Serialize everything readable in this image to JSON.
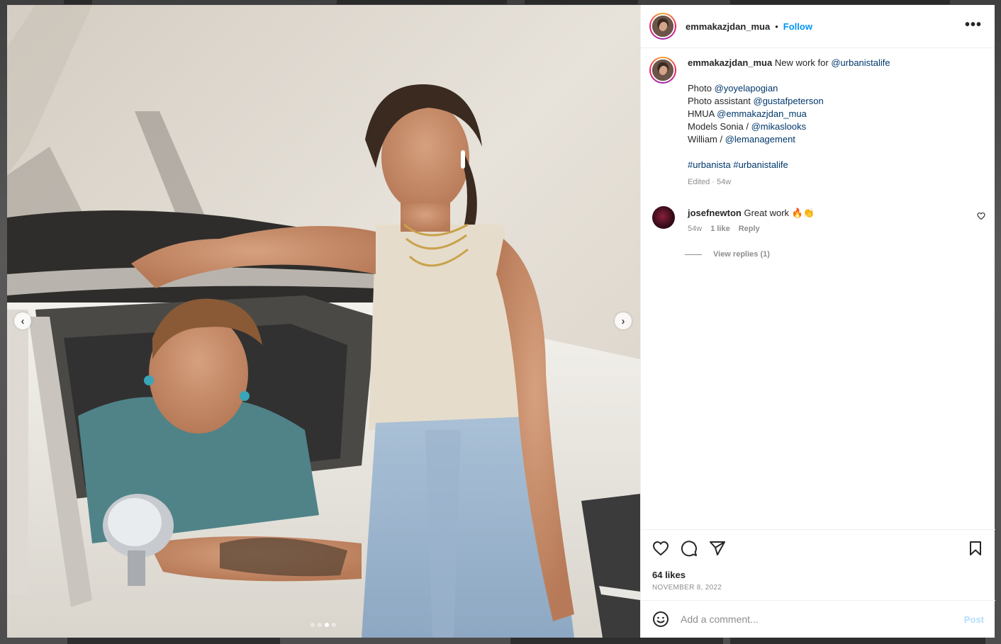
{
  "post": {
    "username": "emmakazjdan_mua",
    "separator": "•",
    "follow_label": "Follow",
    "more_label": "•••",
    "carousel": {
      "prev_label": "‹",
      "next_label": "›",
      "slide_count": 4,
      "active_slide": 3
    }
  },
  "caption": {
    "username": "emmakazjdan_mua",
    "intro": "New work for ",
    "intro_mention": "@urbanistalife",
    "lines": [
      {
        "prefix": "Photo ",
        "mention": "@yoyelapogian"
      },
      {
        "prefix": "Photo assistant ",
        "mention": "@gustafpeterson"
      },
      {
        "prefix": "HMUA ",
        "mention": "@emmakazjdan_mua"
      },
      {
        "prefix": "Models Sonia / ",
        "mention": "@mikaslooks"
      },
      {
        "prefix": "William / ",
        "mention": "@lemanagement"
      }
    ],
    "hashtag_1": "#urbanista",
    "hashtag_2": "#urbanistalife",
    "meta": "Edited · 54w"
  },
  "comment": {
    "username": "josefnewton",
    "text": "Great work 🔥👏",
    "age": "54w",
    "likes": "1 like",
    "reply_label": "Reply",
    "view_replies": "View replies (1)"
  },
  "actions": {
    "likes": "64 likes",
    "date": "NOVEMBER 8, 2022"
  },
  "add_comment": {
    "placeholder": "Add a comment...",
    "post_label": "Post"
  },
  "icons": {
    "more": "more-horizontal-icon",
    "like": "heart-icon",
    "comment": "comment-bubble-icon",
    "share": "paper-plane-icon",
    "save": "bookmark-icon",
    "emoji": "smiley-icon"
  },
  "colors": {
    "link": "#00376b",
    "follow": "#0095f6",
    "muted": "#8e8e8e",
    "post_disabled": "#b2dffc"
  }
}
